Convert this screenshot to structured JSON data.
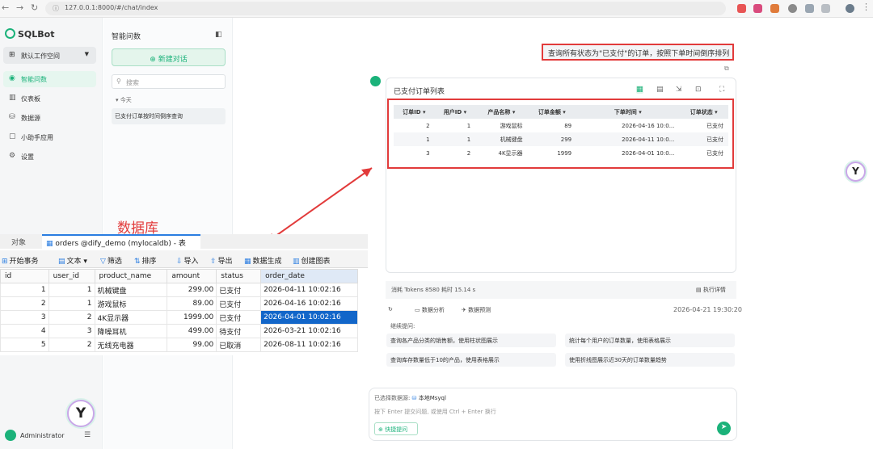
{
  "browser": {
    "url": "127.0.0.1:8000/#/chat/index"
  },
  "sidebar": {
    "app_name": "SQLBot",
    "workspace": "默认工作空间",
    "items": [
      {
        "label": "智能问数"
      },
      {
        "label": "仪表板"
      },
      {
        "label": "数据源"
      },
      {
        "label": "小助手应用"
      },
      {
        "label": "设置"
      }
    ],
    "user": "Administrator"
  },
  "chat_list": {
    "title": "智能问数",
    "new_chat": "新建对话",
    "search_placeholder": "搜索",
    "group_label": "今天",
    "items": [
      "已支付订单按时间倒序查询"
    ]
  },
  "chat": {
    "question": "查询所有状态为\"已支付\"的订单，按照下单时间倒序排列",
    "answer_title": "已支付订单列表",
    "table": {
      "headers": [
        "订单ID",
        "用户ID",
        "产品名称",
        "订单金额",
        "下单时间",
        "订单状态"
      ],
      "rows": [
        [
          "2",
          "1",
          "游戏鼠标",
          "89",
          "2026-04-16 10:0...",
          "已支付"
        ],
        [
          "1",
          "1",
          "机械键盘",
          "299",
          "2026-04-11 10:0...",
          "已支付"
        ],
        [
          "3",
          "2",
          "4K显示器",
          "1999",
          "2026-04-01 10:0...",
          "已支付"
        ]
      ]
    },
    "stats": "消耗 Tokens 8580   耗时 15.14 s",
    "details_label": "执行详情",
    "actions": [
      "数据分析",
      "数据预测"
    ],
    "timestamp": "2026-04-21 19:30:20",
    "continue_label": "继续提问:",
    "suggestions": [
      "查询各产品分类的销售额，使用柱状图展示",
      "统计每个用户的订单数量，使用表格展示",
      "查询库存数量低于10的产品，使用表格展示",
      "使用折线图展示近30天的订单数量趋势"
    ],
    "datasource_label": "已选择数据源:",
    "datasource_name": "本地Msyql",
    "input_hint": "按下 Enter 提交问题, 或使用 Ctrl + Enter 换行",
    "quick_label": "快捷提问"
  },
  "db_overlay": {
    "label": "数据库",
    "tab_objects": "对象",
    "tab_active": "orders @dify_demo (mylocaldb) - 表",
    "toolbar": [
      "开始事务",
      "文本",
      "筛选",
      "排序",
      "导入",
      "导出",
      "数据生成",
      "创建图表"
    ],
    "columns": [
      "id",
      "user_id",
      "product_name",
      "amount",
      "status",
      "order_date"
    ],
    "rows": [
      [
        "1",
        "1",
        "机械键盘",
        "299.00",
        "已支付",
        "2026-04-11 10:02:16"
      ],
      [
        "2",
        "1",
        "游戏鼠标",
        "89.00",
        "已支付",
        "2026-04-16 10:02:16"
      ],
      [
        "3",
        "2",
        "4K显示器",
        "1999.00",
        "已支付",
        "2026-04-01 10:02:16"
      ],
      [
        "4",
        "3",
        "降噪耳机",
        "499.00",
        "待支付",
        "2026-03-21 10:02:16"
      ],
      [
        "5",
        "2",
        "无线充电器",
        "99.00",
        "已取消",
        "2026-08-11 10:02:16"
      ]
    ]
  }
}
